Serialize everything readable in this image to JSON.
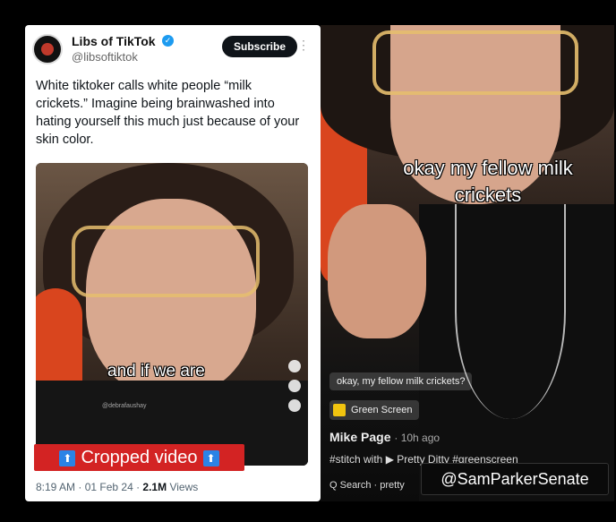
{
  "tweet": {
    "account_name": "Libs of TikTok",
    "handle": "@libsoftiktok",
    "subscribe_label": "Subscribe",
    "text": "White tiktoker calls white people “milk crickets.” Imagine being brainwashed into hating yourself this much just because of your skin color.",
    "video_caption": "and if we are",
    "banner_label": "Cropped video",
    "arrow_glyph": "⬆",
    "time": "8:19 AM",
    "date": "01 Feb 24",
    "views_count": "2.1M",
    "views_label": "Views",
    "watermark": "@debrafaushay"
  },
  "tiktok": {
    "caption": "okay my fellow milk crickets",
    "comment": "okay, my fellow milk crickets?",
    "effect_label": "Green Screen",
    "author": "Mike Page",
    "time_ago": "· 10h ago",
    "stitch_text": "#stitch with ▶ Pretty Ditty #greenscreen",
    "search_label": "Q Search · pretty",
    "overlay_handle": "@SamParkerSenate"
  },
  "colors": {
    "banner": "#d32323",
    "verified": "#1d9bf0",
    "arrow_box": "#2b83e6"
  },
  "icons": [
    "verified-badge-icon",
    "more-icon",
    "arrow-up-icon",
    "green-screen-icon"
  ]
}
